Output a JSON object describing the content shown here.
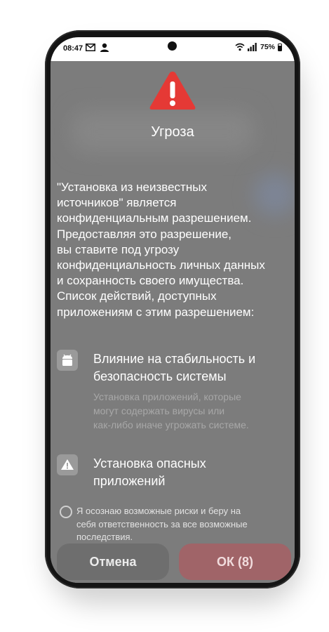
{
  "status_bar": {
    "time": "08:47",
    "battery": "75%"
  },
  "dialog": {
    "title": "Угроза",
    "body": "\"Установка из неизвестных\nисточников\" является\nконфиденциальным разрешением.\nПредоставляя это разрешение,\nвы ставите под угрозу\nконфиденциальность личных данных\nи сохранность своего имущества.\nСписок действий, доступных\nприложениям с этим разрешением:",
    "permissions": [
      {
        "title": "Влияние на стабильность и\nбезопасность системы",
        "description": "Установка приложений, которые\nмогут содержать вирусы или\nкак-либо иначе угрожать системе.",
        "icon": "android-icon"
      },
      {
        "title": "Установка опасных\nприложений",
        "icon": "warning-triangle-icon"
      }
    ],
    "acknowledge": "Я осознаю возможные риски и беру на\nсебя ответственность за все возможные\nпоследствия.",
    "cancel_label": "Отмена",
    "ok_label": "ОК (8)"
  },
  "colors": {
    "danger": "#e53935",
    "ok_button": "#a06468",
    "cancel_button": "#6e6e6e"
  }
}
